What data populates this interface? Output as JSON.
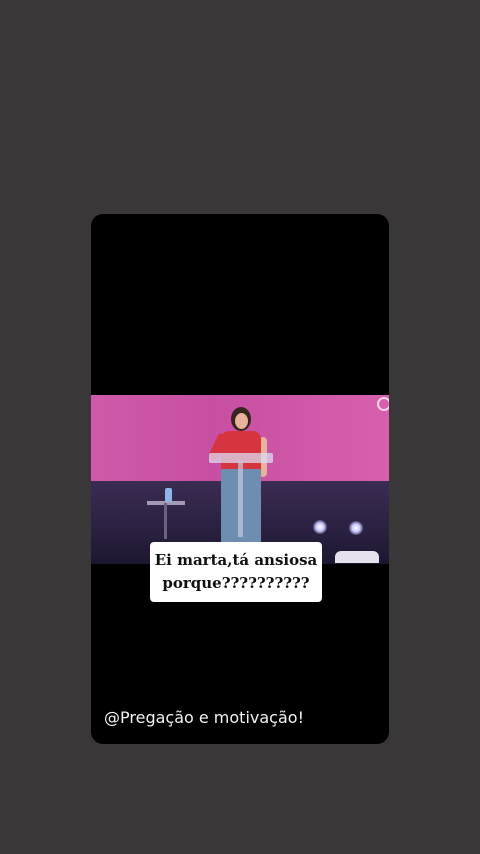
{
  "story": {
    "caption_line1": "Ei marta,tá ansiosa",
    "caption_line2": "porque??????????",
    "watermark": "@Pregação e motivação!"
  },
  "colors": {
    "page_background": "#3a3738",
    "card_background": "#000000",
    "backdrop_pink": "#c74fa2",
    "shirt_red": "#d6343f",
    "caption_background": "#ffffff"
  }
}
